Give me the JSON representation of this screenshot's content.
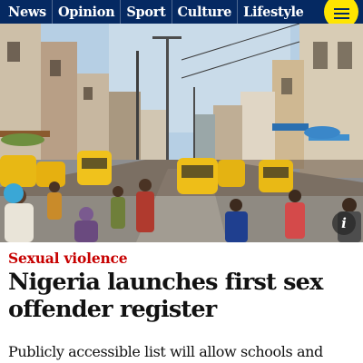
{
  "nav": {
    "items": [
      {
        "label": "News"
      },
      {
        "label": "Opinion"
      },
      {
        "label": "Sport"
      },
      {
        "label": "Culture"
      },
      {
        "label": "Lifestyle"
      }
    ],
    "menu_icon": "hamburger-menu-icon"
  },
  "article": {
    "kicker": "Sexual violence",
    "headline": "Nigeria launches first sex offender register",
    "standfirst": "Publicly accessible list will allow schools and hospitals to"
  },
  "hero": {
    "info_label": "i",
    "info_icon": "info-icon"
  },
  "colors": {
    "nav_background": "#052962",
    "menu_button": "#ffe500",
    "kicker": "#c70000",
    "headline": "#121212"
  }
}
